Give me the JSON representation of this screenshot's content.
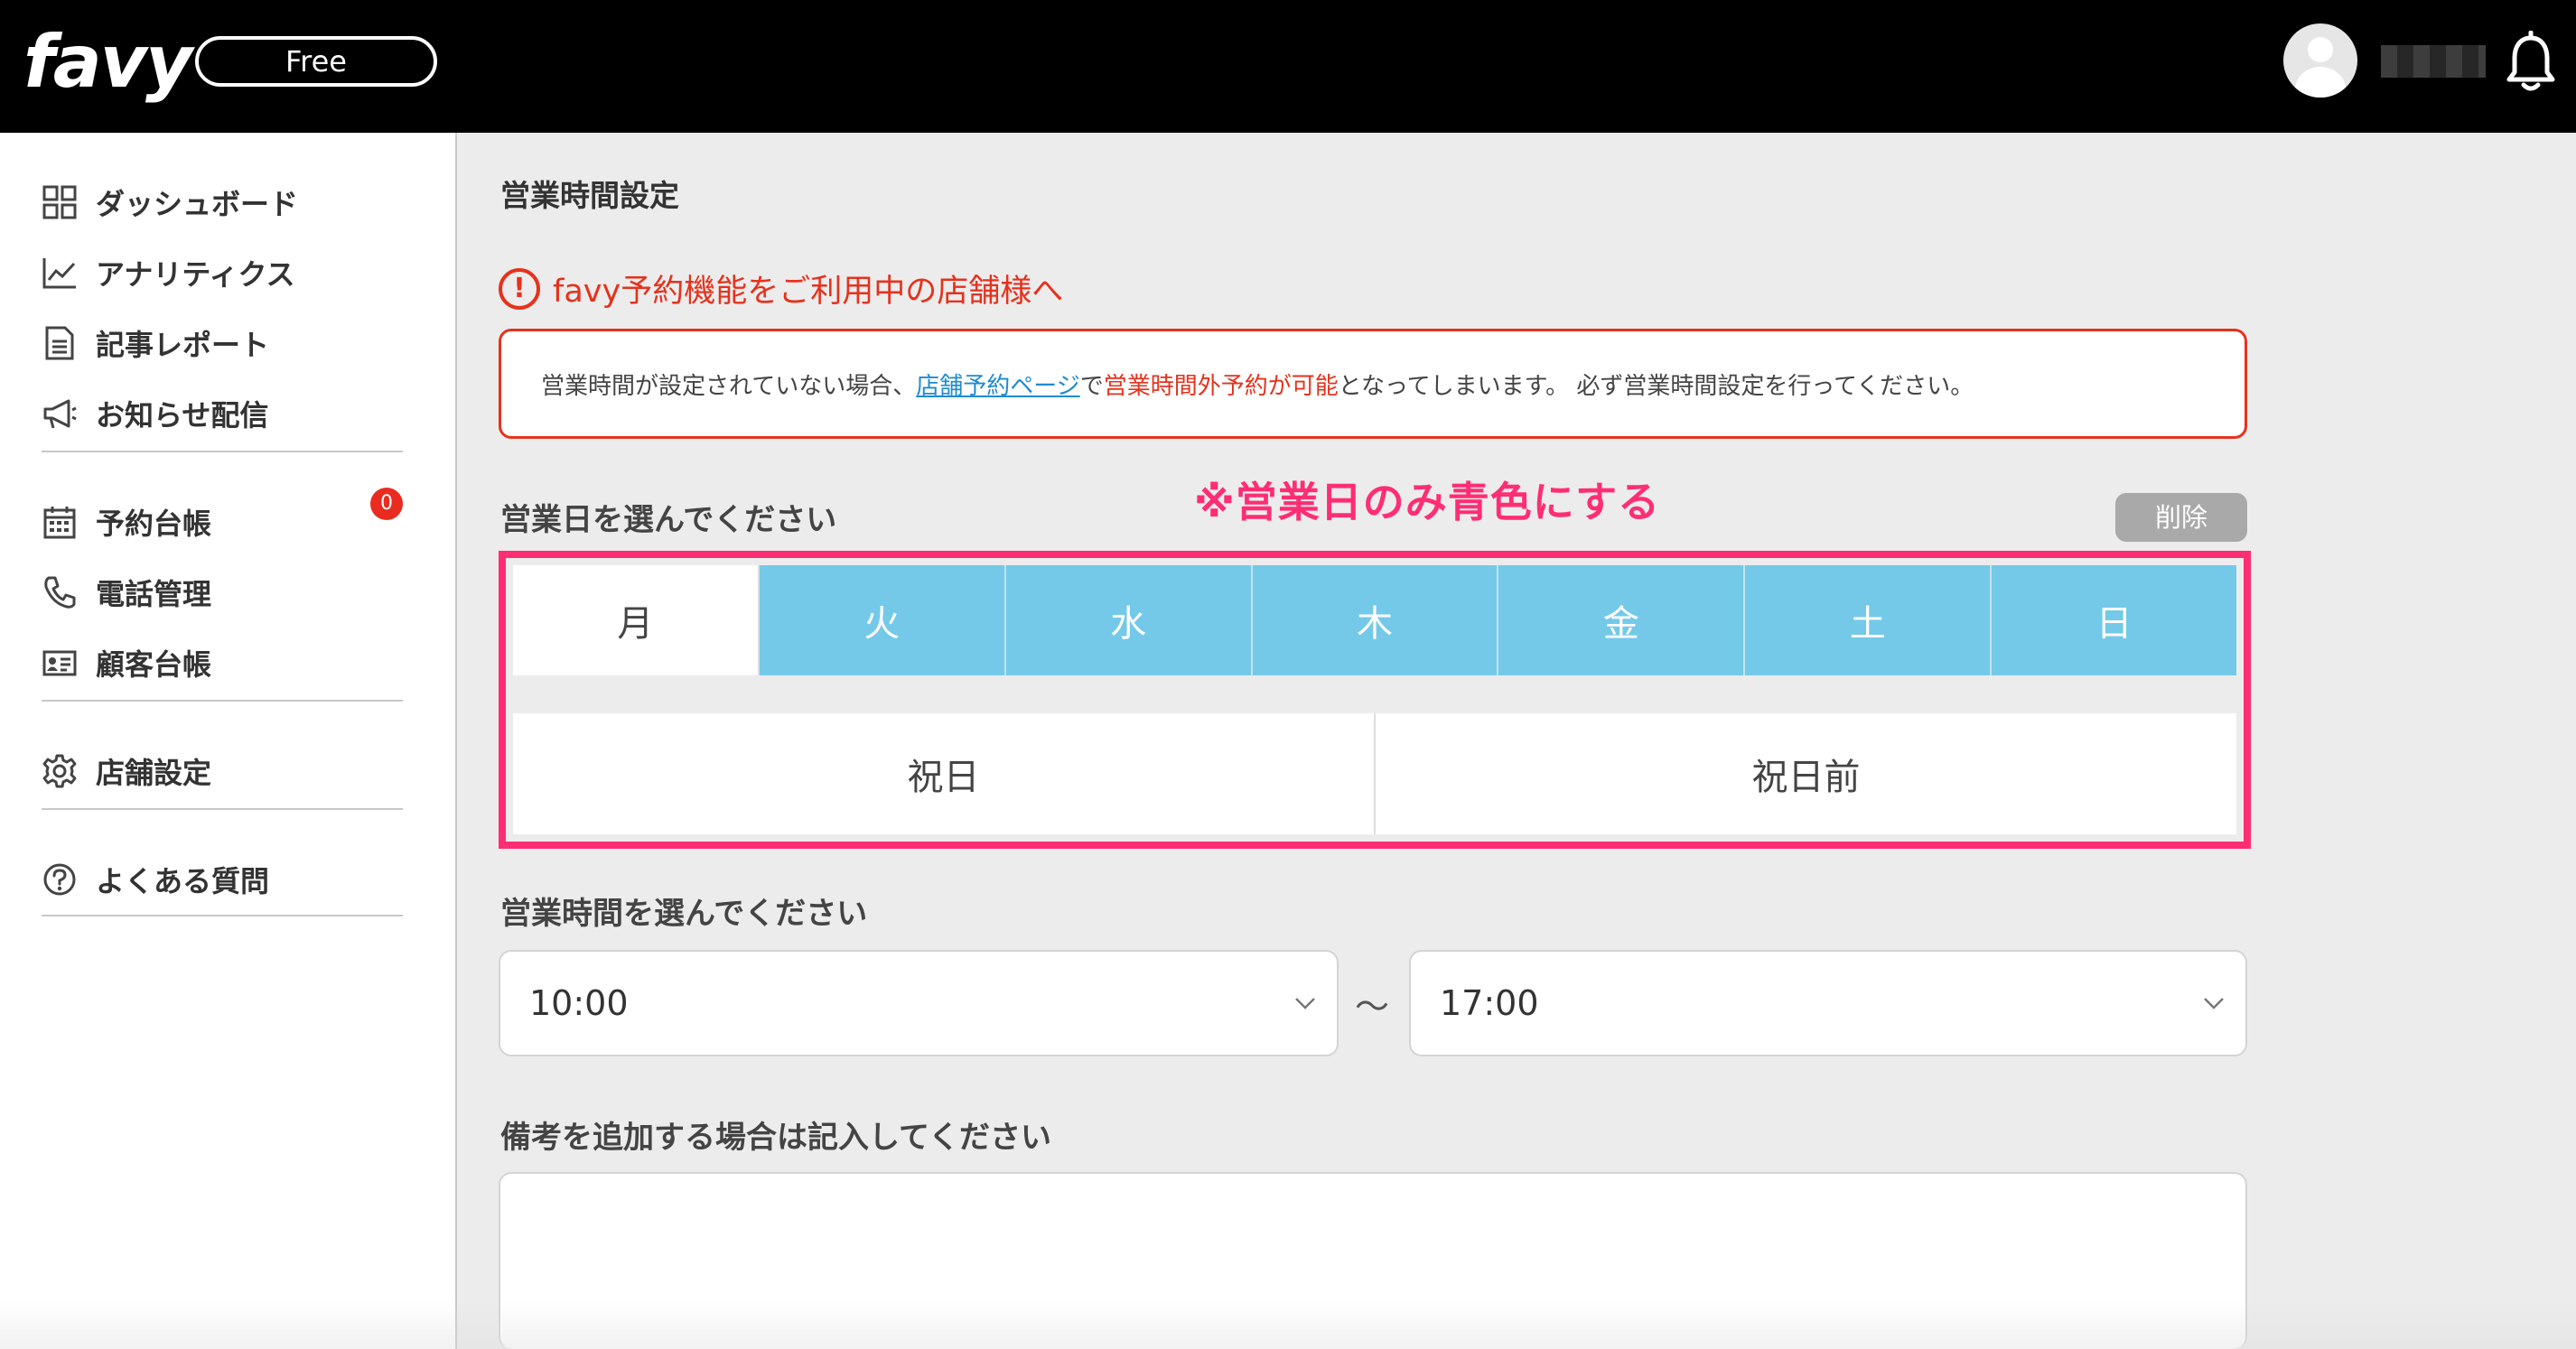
{
  "header": {
    "logo": "favy",
    "plan": "Free"
  },
  "sidebar": {
    "items": [
      {
        "label": "ダッシュボード",
        "icon": "grid-icon"
      },
      {
        "label": "アナリティクス",
        "icon": "line-chart-icon"
      },
      {
        "label": "記事レポート",
        "icon": "document-icon"
      },
      {
        "label": "お知らせ配信",
        "icon": "megaphone-icon"
      },
      {
        "label": "予約台帳",
        "icon": "calendar-icon"
      },
      {
        "label": "電話管理",
        "icon": "phone-icon"
      },
      {
        "label": "顧客台帳",
        "icon": "id-card-icon"
      },
      {
        "label": "店舗設定",
        "icon": "gear-icon"
      },
      {
        "label": "よくある質問",
        "icon": "question-icon"
      }
    ],
    "reservation_badge": "0"
  },
  "main": {
    "title": "営業時間設定",
    "notice_title": "favy予約機能をご利用中の店舗様へ",
    "notice": {
      "part1": "営業時間が設定されていない場合、",
      "link": "店舗予約ページ",
      "part2": "で",
      "red": "営業時間外予約が可能",
      "part3": "となってしまいます。 必ず営業時間設定を行ってください。"
    },
    "days_label": "営業日を選んでください",
    "annotation": "※営業日のみ青色にする",
    "delete_label": "削除",
    "days": [
      {
        "label": "月",
        "selected": false
      },
      {
        "label": "火",
        "selected": true
      },
      {
        "label": "水",
        "selected": true
      },
      {
        "label": "木",
        "selected": true
      },
      {
        "label": "金",
        "selected": true
      },
      {
        "label": "土",
        "selected": true
      },
      {
        "label": "日",
        "selected": true
      }
    ],
    "holidays": [
      "祝日",
      "祝日前"
    ],
    "hours_label": "営業時間を選んでください",
    "start_time": "10:00",
    "separator": "〜",
    "end_time": "17:00",
    "memo_label": "備考を追加する場合は記入してください",
    "memo_value": ""
  },
  "colors": {
    "selected_day": "#74c9e8",
    "warning_red": "#e5321d",
    "annotation_pink": "#ff2d74",
    "badge_red": "#ea2b1f"
  }
}
